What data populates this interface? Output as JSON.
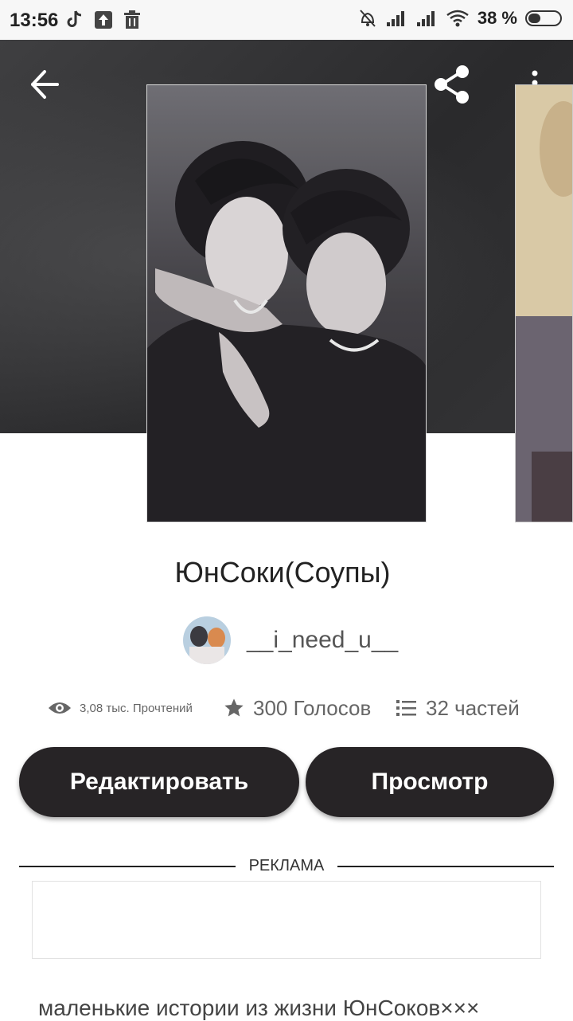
{
  "status_bar": {
    "time": "13:56",
    "battery_text": "38 %",
    "left_icons": [
      "tiktok-icon",
      "upload-icon",
      "trash-icon"
    ],
    "right_icons": [
      "bell-off-icon",
      "signal-icon",
      "signal-icon",
      "wifi-icon",
      "battery-icon"
    ]
  },
  "toolbar": {
    "back_icon": "arrow-left-icon",
    "share_icon": "share-icon",
    "more_icon": "more-vertical-icon"
  },
  "story": {
    "title": "ЮнСоки(Соупы)",
    "author": "__i_need_u__",
    "reads": "3,08 тыс. Прочтений",
    "votes": "300 Голосов",
    "parts": "32 частей",
    "description": "маленькие истории из жизни ЮнСоков×××"
  },
  "actions": {
    "edit_label": "Редактировать",
    "view_label": "Просмотр"
  },
  "ad": {
    "label": "РЕКЛАМА"
  },
  "colors": {
    "button_bg": "#272426",
    "hero_bg": "#2f2f31"
  }
}
